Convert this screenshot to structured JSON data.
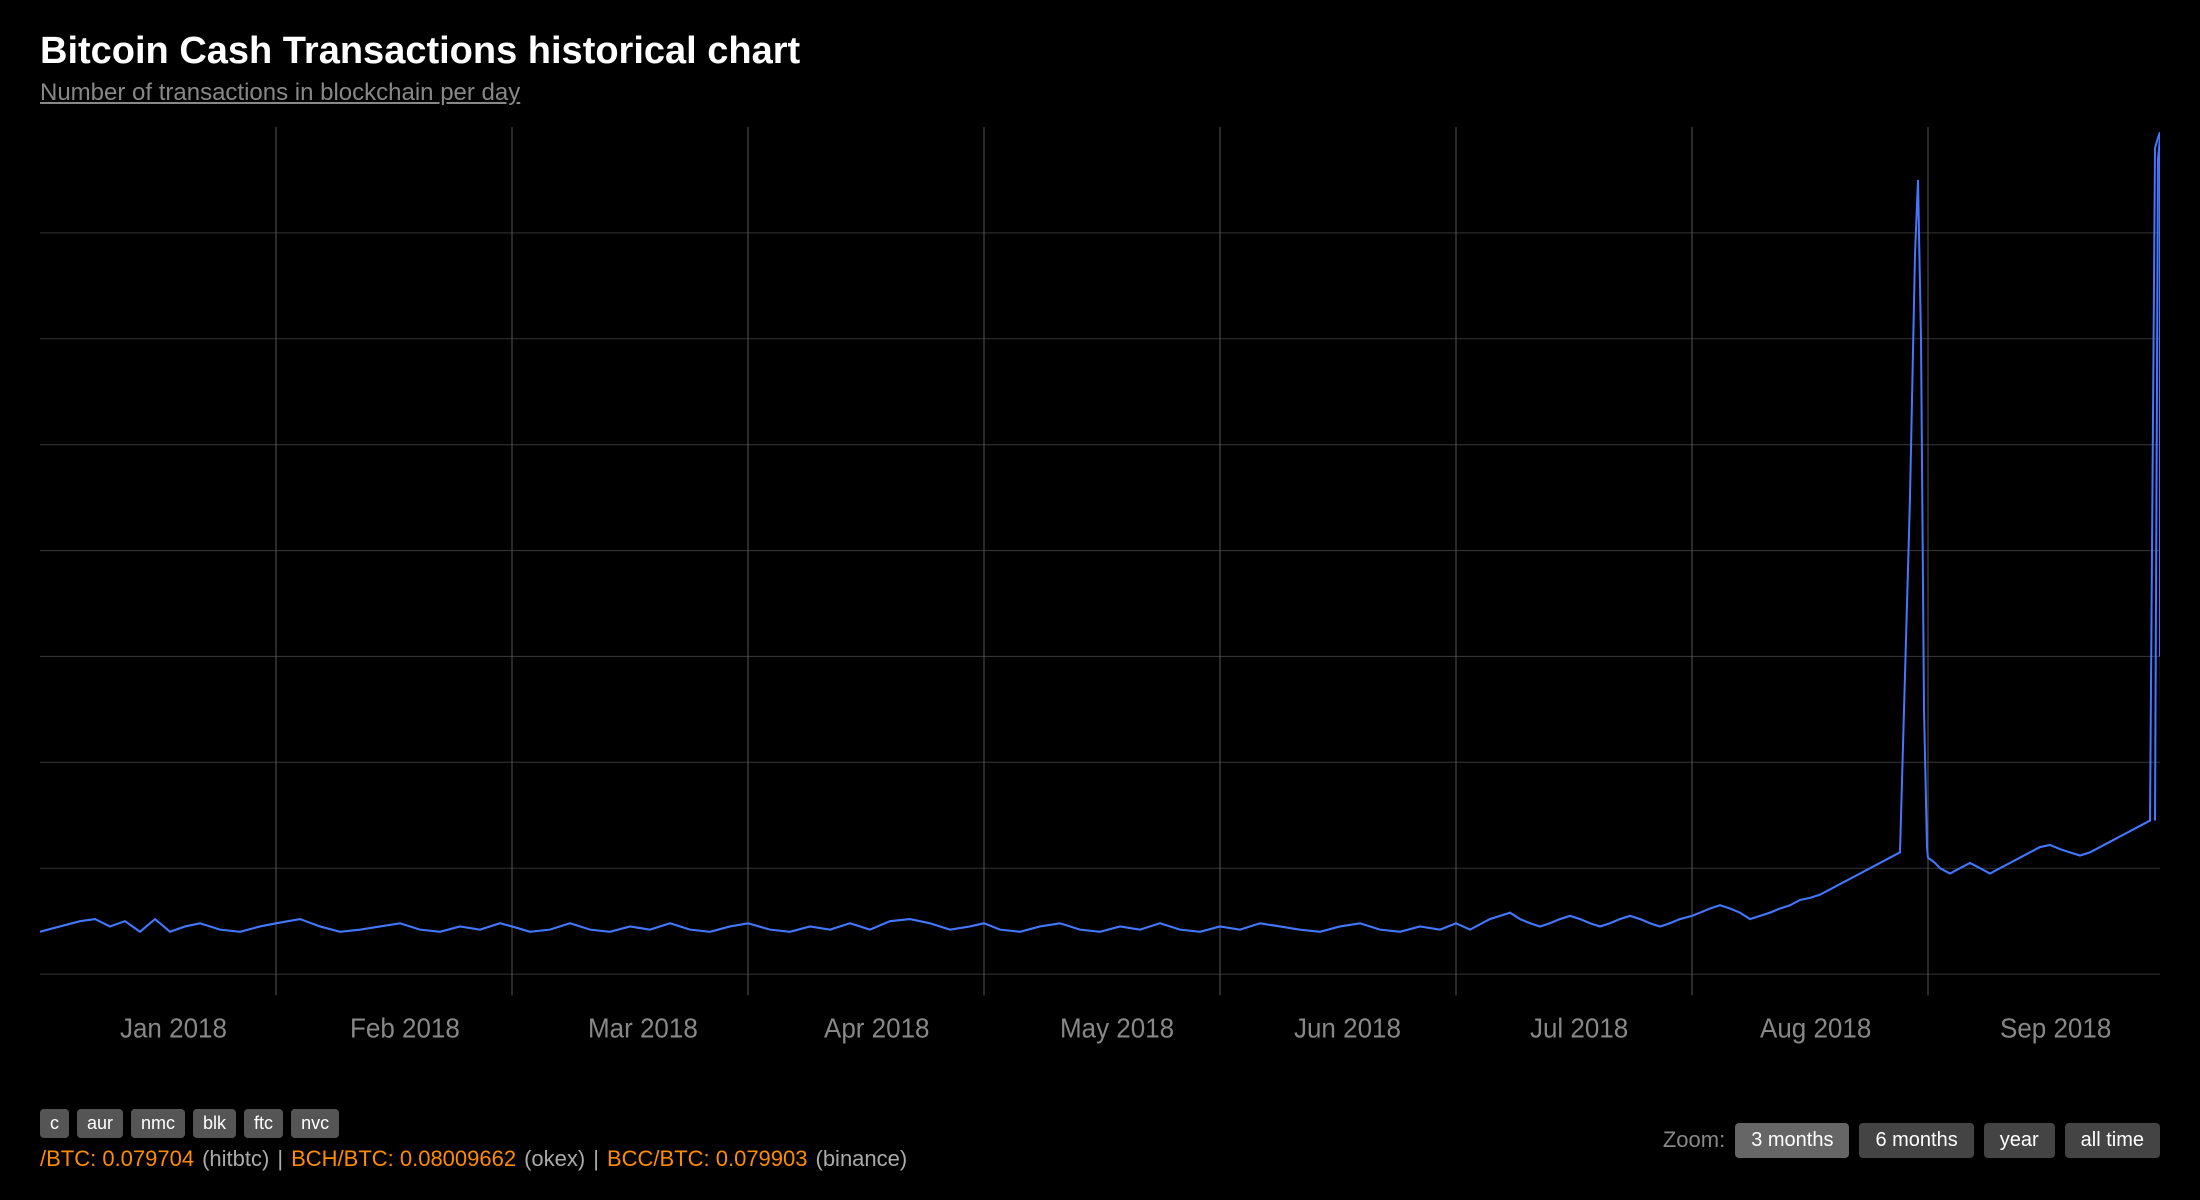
{
  "header": {
    "title": "Bitcoin Cash Transactions historical chart",
    "subtitle": "Number of transactions in blockchain per day"
  },
  "chart": {
    "x_labels": [
      "Jan 2018",
      "Feb 2018",
      "Mar 2018",
      "Apr 2018",
      "May 2018",
      "Jun 2018",
      "Jul 2018",
      "Aug 2018",
      "Sep 2018"
    ],
    "line_color": "#4477ff",
    "grid_color": "#333",
    "accent_color": "#5588ff"
  },
  "tags": [
    "c",
    "aur",
    "nmc",
    "blk",
    "ftc",
    "nvc"
  ],
  "prices": [
    {
      "label": "/BTC: 0.079704",
      "exchange": "hitbtc"
    },
    {
      "label": "BCH/BTC: 0.08009662",
      "exchange": "okex"
    },
    {
      "label": "BCC/BTC: 0.079903",
      "exchange": "binance"
    }
  ],
  "zoom": {
    "label": "Zoom:",
    "options": [
      "3 months",
      "6 months",
      "year",
      "all time"
    ],
    "active": "3 months"
  }
}
